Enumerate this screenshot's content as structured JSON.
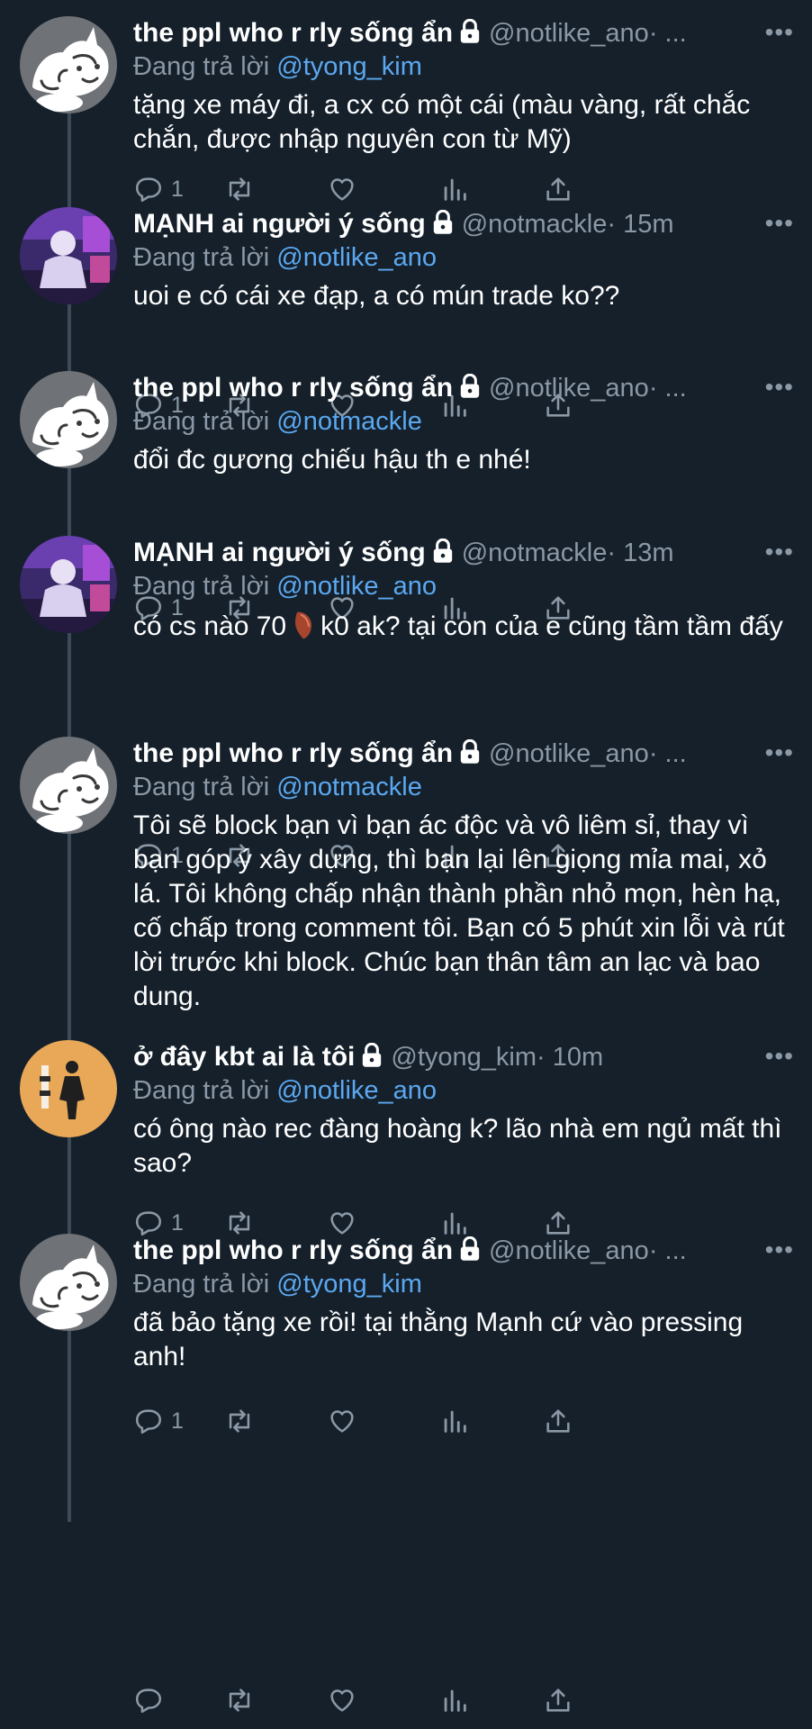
{
  "reply_prefix": "Đang trả lời",
  "tweets": [
    {
      "name": "the ppl who r rly sống ẩn",
      "handle": "@notlike_ano",
      "meta": " · ...",
      "reply_to": "@tyong_kim",
      "text": "tặng xe máy đi, a cx có một cái (màu vàng, rất chắc chắn, được nhập nguyên con từ Mỹ)",
      "replies": "1",
      "avatar": "cat-face-avatar"
    },
    {
      "name": "MẠNH ai người ý sống",
      "handle": "@notmackle",
      "meta": " · 15m",
      "reply_to": "@notlike_ano",
      "text": "uoi e có cái xe đạp, a có mún trade ko??",
      "replies": "1",
      "avatar": "purple-scene-avatar"
    },
    {
      "name": "the ppl who r rly sống ẩn",
      "handle": "@notlike_ano",
      "meta": " · ...",
      "reply_to": "@notmackle",
      "text": "đổi đc gương chiếu hậu th e nhé!",
      "replies": "1",
      "avatar": "cat-face-avatar"
    },
    {
      "name": "MẠNH ai người ý sống",
      "handle": "@notmackle",
      "meta": " · 13m",
      "reply_to": "@notlike_ano",
      "text_before": "có cs nào 70",
      "text_after": "k0 ak? tại con của e cũng tầm tầm đấy",
      "replies": "1",
      "avatar": "purple-scene-avatar"
    },
    {
      "name": "the ppl who r rly sống ẩn",
      "handle": "@notlike_ano",
      "meta": " · ...",
      "reply_to": "@notmackle",
      "text": "Tôi sẽ block bạn vì bạn ác độc và vô liêm sỉ, thay vì bạn góp ý xây dựng, thì bạn lại lên giọng mỉa mai, xỏ lá. Tôi không chấp nhận thành phần nhỏ mọn, hèn hạ, cố chấp trong comment tôi. Bạn có 5 phút xin lỗi và rút lời trước khi block. Chúc bạn thân tâm an lạc và bao dung.",
      "replies": "1",
      "avatar": "cat-face-avatar"
    },
    {
      "name": "ở đây kbt ai là tôi",
      "handle": "@tyong_kim",
      "meta": " · 10m",
      "reply_to": "@notlike_ano",
      "text": "có ông nào rec đàng hoàng k? lão nhà em ngủ mất thì sao?",
      "replies": "1",
      "avatar": "tan-photo-avatar"
    },
    {
      "name": "the ppl who r rly sống ẩn",
      "handle": "@notlike_ano",
      "meta": " · ...",
      "reply_to": "@tyong_kim",
      "text": "đã bảo tặng xe rồi! tại thằng Mạnh cứ vào pressing anh!",
      "replies": "",
      "avatar": "cat-face-avatar"
    }
  ],
  "colors": {
    "background": "#15202b",
    "secondary_text": "#8b98a5",
    "link": "#5ba8f0",
    "thread_line": "#3d4a57"
  }
}
